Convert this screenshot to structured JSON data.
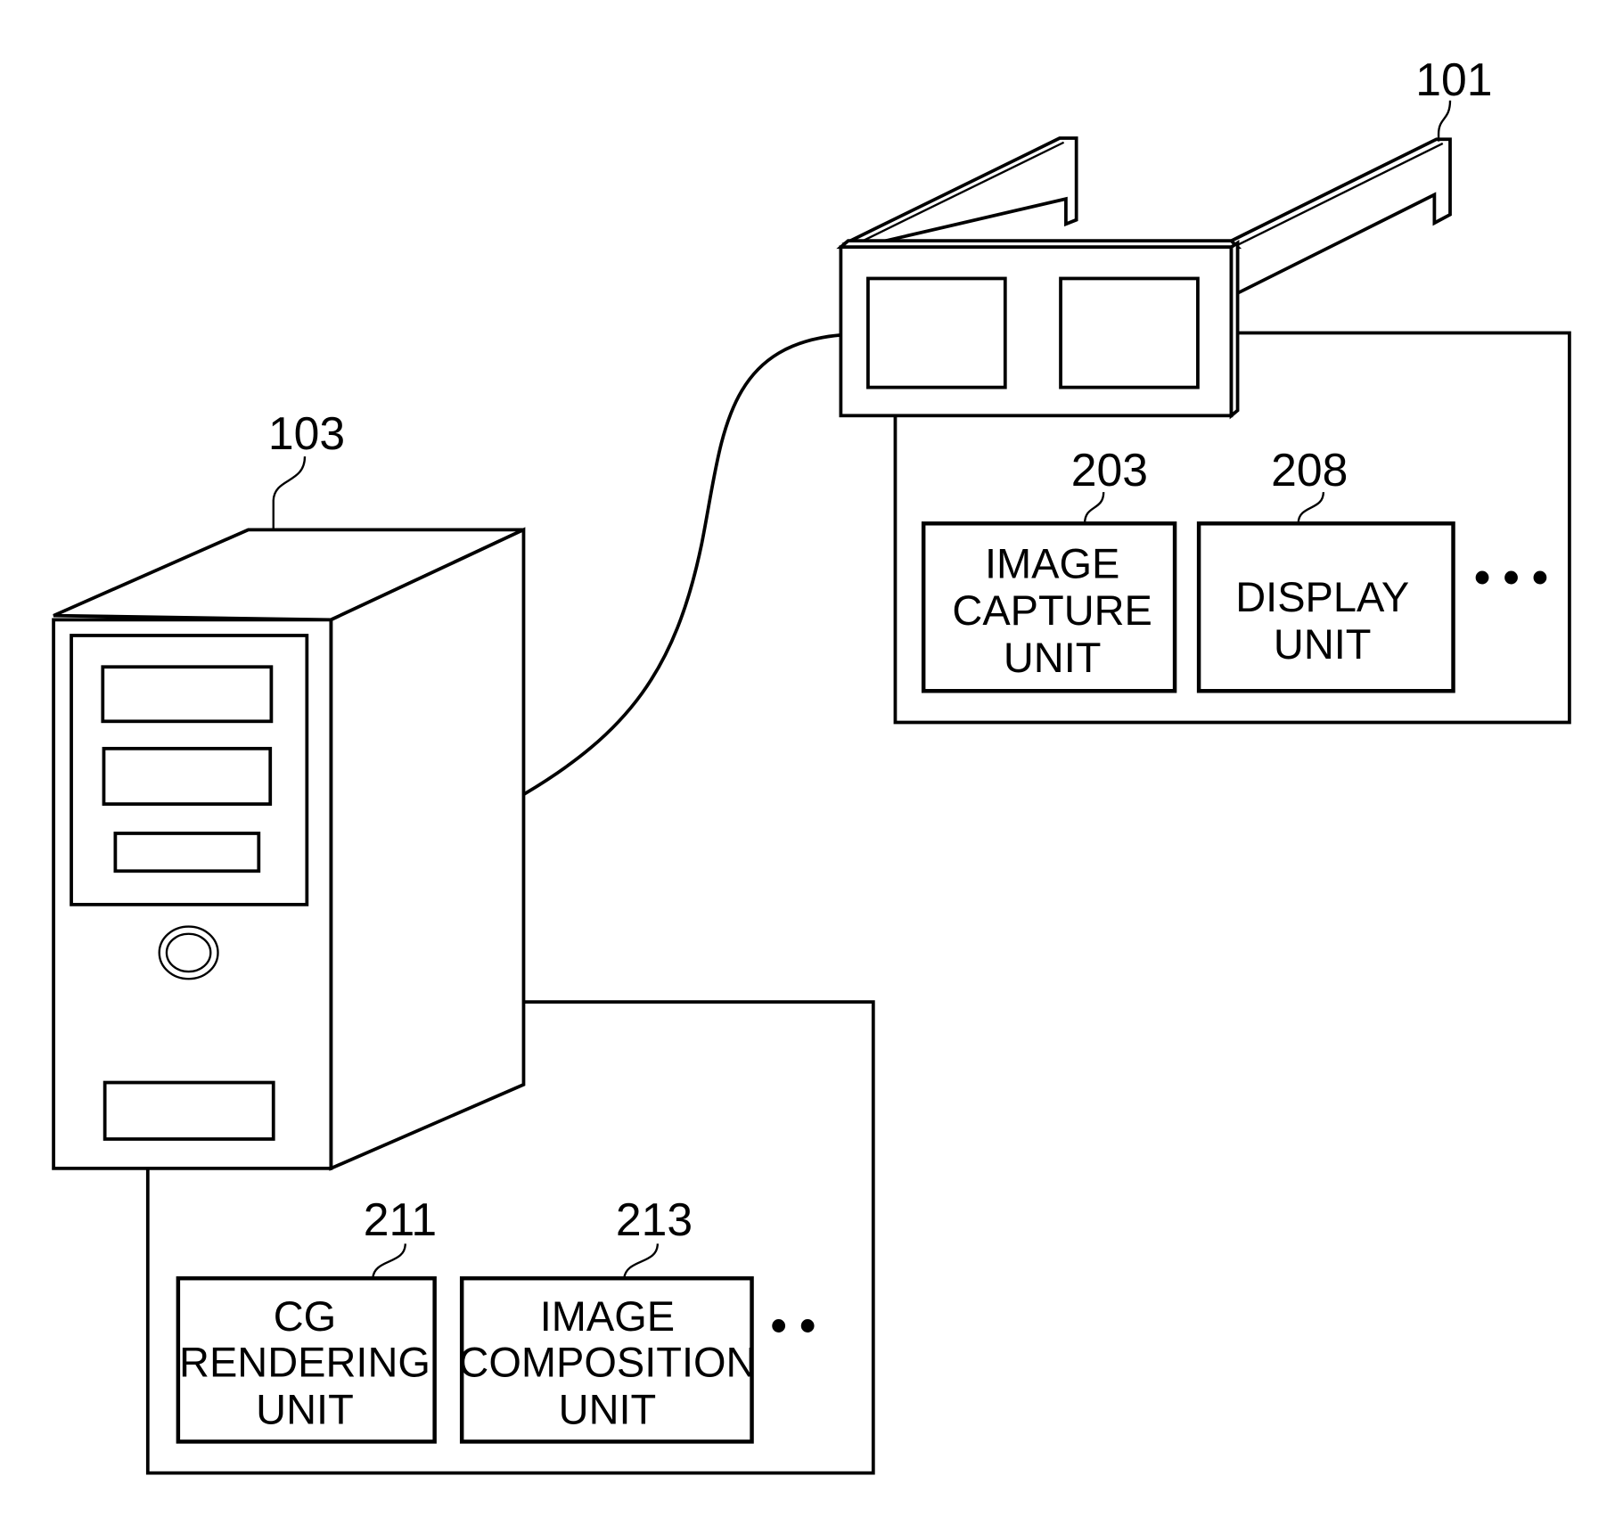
{
  "figure": {
    "devices": {
      "hmd": {
        "ref": "101",
        "name": "head-mounted display"
      },
      "computer": {
        "ref": "103",
        "name": "computer tower"
      }
    },
    "hmd_units": [
      {
        "ref": "203",
        "lines": [
          "IMAGE",
          "CAPTURE",
          "UNIT"
        ]
      },
      {
        "ref": "208",
        "lines": [
          "DISPLAY",
          "UNIT"
        ]
      }
    ],
    "hmd_more": "• • •",
    "computer_units": [
      {
        "ref": "211",
        "lines": [
          "CG",
          "RENDERING",
          "UNIT"
        ]
      },
      {
        "ref": "213",
        "lines": [
          "IMAGE",
          "COMPOSITION",
          "UNIT"
        ]
      }
    ],
    "computer_more": "• •"
  }
}
